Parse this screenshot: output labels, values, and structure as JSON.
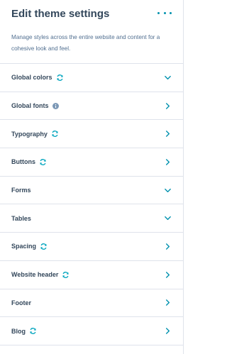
{
  "header": {
    "title": "Edit theme settings",
    "description": "Manage styles across the entire website and content for a cohesive look and feel."
  },
  "items": [
    {
      "label": "Global colors",
      "badge": "sync-icon",
      "chevron": "chevron-down-icon"
    },
    {
      "label": "Global fonts",
      "badge": "info-icon",
      "chevron": "chevron-right-icon"
    },
    {
      "label": "Typography",
      "badge": "sync-icon",
      "chevron": "chevron-right-icon"
    },
    {
      "label": "Buttons",
      "badge": "sync-icon",
      "chevron": "chevron-right-icon"
    },
    {
      "label": "Forms",
      "badge": "",
      "chevron": "chevron-down-icon"
    },
    {
      "label": "Tables",
      "badge": "",
      "chevron": "chevron-down-icon"
    },
    {
      "label": "Spacing",
      "badge": "sync-icon",
      "chevron": "chevron-right-icon"
    },
    {
      "label": "Website header",
      "badge": "sync-icon",
      "chevron": "chevron-right-icon"
    },
    {
      "label": "Footer",
      "badge": "",
      "chevron": "chevron-right-icon"
    },
    {
      "label": "Blog",
      "badge": "sync-icon",
      "chevron": "chevron-right-icon"
    }
  ],
  "colors": {
    "accent": "#0091ae",
    "text": "#33475b",
    "muted_text": "#516f90",
    "sync": "#00a4bd",
    "info": "#7c98b6",
    "border": "#dfe3eb"
  }
}
